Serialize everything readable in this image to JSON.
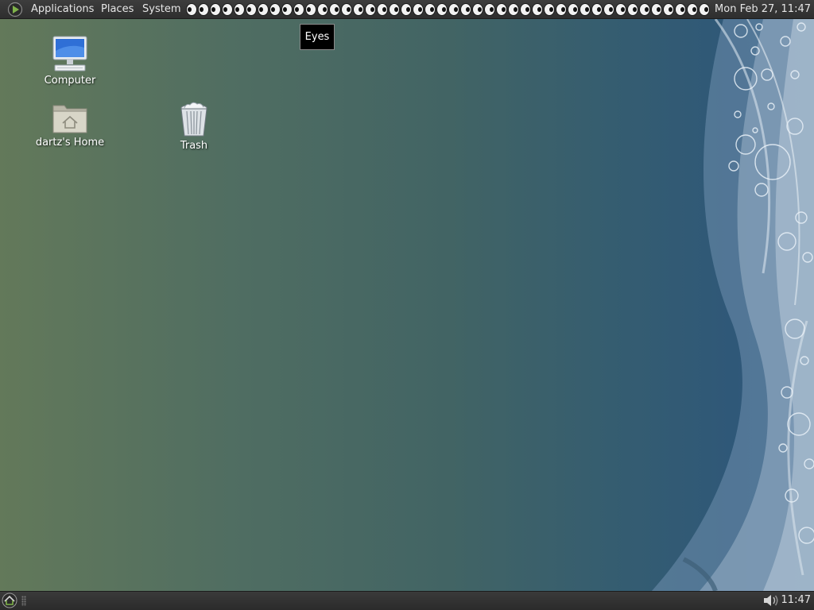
{
  "top_panel": {
    "menus": {
      "applications": "Applications",
      "places": "Places",
      "system": "System"
    },
    "eyes_applet": {
      "name": "Eyes",
      "eye_count": 44
    },
    "clock": "Mon Feb 27, 11:47"
  },
  "tooltip": {
    "text": "Eyes"
  },
  "desktop": {
    "icons": {
      "computer": "Computer",
      "home": "dartz's Home",
      "trash": "Trash"
    }
  },
  "bottom_panel": {
    "clock": "11:47",
    "icons": [
      "show-desktop-icon",
      "volume-icon"
    ]
  },
  "colors": {
    "panel": "#2e2e2e",
    "panel_text": "#e6e6e6",
    "wallpaper_left": "#63795a",
    "wallpaper_right": "#335b80"
  }
}
